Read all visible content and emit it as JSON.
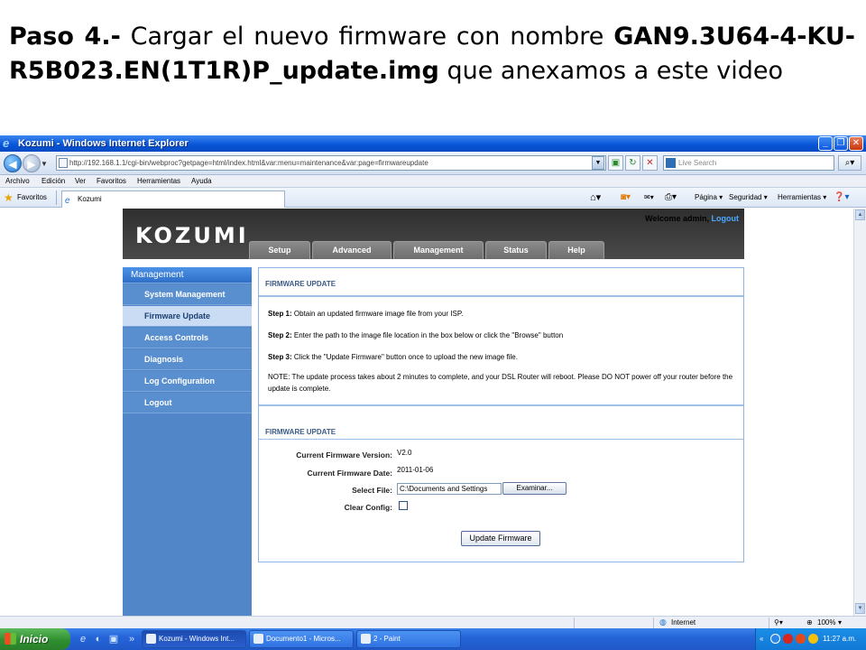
{
  "slide": {
    "heading_prefix_bold": "Paso 4.-",
    "heading_text": " Cargar el nuevo firmware con nombre ",
    "heading_file_bold": "GAN9.3U64-4-KU-R5B023.EN(1T1R)P_update.img",
    "heading_suffix": " que anexamos a este video"
  },
  "browser": {
    "title": "Kozumi - Windows Internet Explorer",
    "url": "http://192.168.1.1/cgi-bin/webproc?getpage=html/index.html&var:menu=maintenance&var:page=firmwareupdate",
    "search_placeholder": "Live Search",
    "menu": [
      "Archivo",
      "Edición",
      "Ver",
      "Favoritos",
      "Herramientas",
      "Ayuda"
    ],
    "favorites_label": "Favoritos",
    "tab_label": "Kozumi",
    "commands": [
      "Página ▾",
      "Seguridad ▾",
      "Herramientas ▾"
    ],
    "status": {
      "zone": "Internet",
      "zoom": "100%"
    }
  },
  "router": {
    "logo": "KOZUMI",
    "welcome": "Welcome admin,",
    "logout_link": "Logout",
    "top_tabs": [
      "Setup",
      "Advanced",
      "Management",
      "Status",
      "Help"
    ],
    "sidebar": {
      "title": "Management",
      "items": [
        "System Management",
        "Firmware Update",
        "Access Controls",
        "Diagnosis",
        "Log Configuration",
        "Logout"
      ],
      "active_index": 1
    },
    "content": {
      "section1_title": "FIRMWARE UPDATE",
      "step1_label": "Step 1:",
      "step1_text": " Obtain an updated firmware image file from your ISP.",
      "step2_label": "Step 2:",
      "step2_text": " Enter the path to the image file location in the box below or click the \"Browse\" button",
      "step3_label": "Step 3:",
      "step3_text": " Click the \"Update Firmware\" button once to upload the new image file.",
      "note": "NOTE: The update process takes about 2 minutes to complete, and your DSL Router will reboot. Please DO NOT power off your router before the update is complete.",
      "section2_title": "FIRMWARE UPDATE",
      "current_version_label": "Current Firmware Version:",
      "current_version": "V2.0",
      "current_date_label": "Current Firmware Date:",
      "current_date": "2011-01-06",
      "select_file_label": "Select File:",
      "select_file_value": "C:\\Documents and Settings",
      "browse_label": "Examinar...",
      "clear_config_label": "Clear Config:",
      "update_button": "Update Firmware"
    }
  },
  "taskbar": {
    "start_label": "Inicio",
    "tasks": [
      "Kozumi - Windows Int...",
      "Documento1 - Micros...",
      "2 - Paint"
    ],
    "clock": "11:27 a.m."
  },
  "colors": {
    "xp_blue": "#0a57d8",
    "router_header": "#3a3a3a",
    "sidebar_blue": "#5187c9",
    "section_line": "#9fc0e8"
  }
}
